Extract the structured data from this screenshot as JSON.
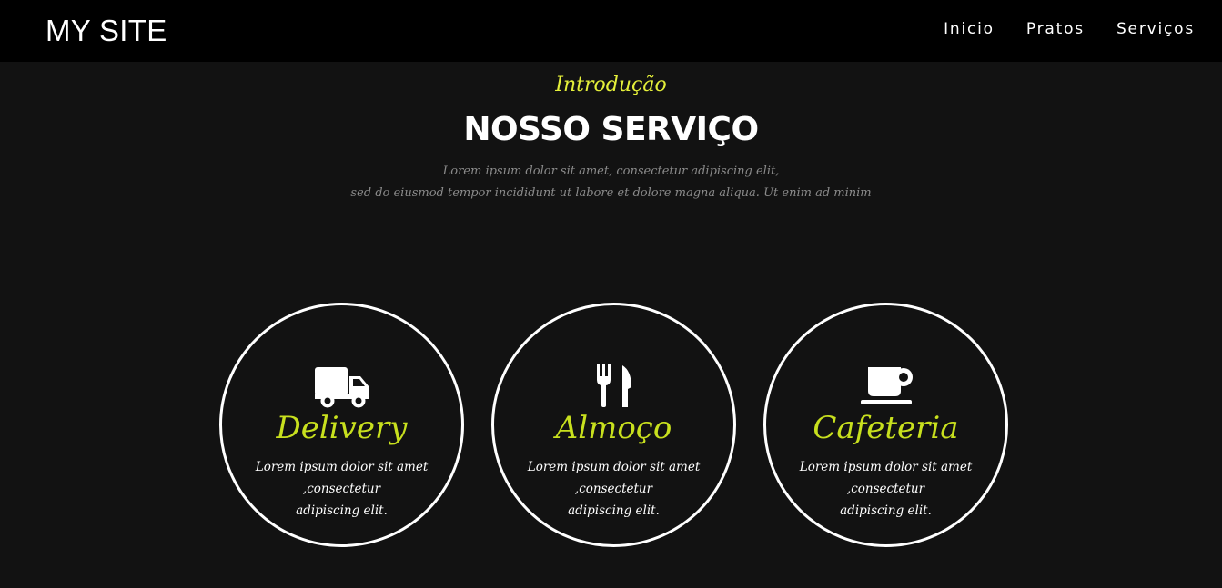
{
  "navbar": {
    "logo": "MY SITE",
    "links": [
      "Inicio",
      "Pratos",
      "Serviços"
    ]
  },
  "section": {
    "intro": "Introdução",
    "title": "NOSSO SERVIÇO",
    "desc_line1": "Lorem ipsum dolor sit amet, consectetur adipiscing elit,",
    "desc_line2": "sed do eiusmod tempor incididunt ut labore et dolore magna aliqua. Ut enim ad minim"
  },
  "cards": [
    {
      "icon": "truck-icon",
      "title": "Delivery",
      "line1": "Lorem ipsum dolor sit amet",
      "line2": ",consectetur",
      "line3": "adipiscing elit."
    },
    {
      "icon": "utensils-icon",
      "title": "Almoço",
      "line1": "Lorem ipsum dolor sit amet",
      "line2": ",consectetur",
      "line3": "adipiscing elit."
    },
    {
      "icon": "coffee-cup-icon",
      "title": "Cafeteria",
      "line1": "Lorem ipsum dolor sit amet",
      "line2": ",consectetur",
      "line3": "adipiscing elit."
    }
  ],
  "colors": {
    "navbar_bg": "#000000",
    "page_bg": "#121212",
    "accent_yellow": "#e4ef3a",
    "card_title": "#c8e01e",
    "muted_text": "#8a8a8a"
  }
}
